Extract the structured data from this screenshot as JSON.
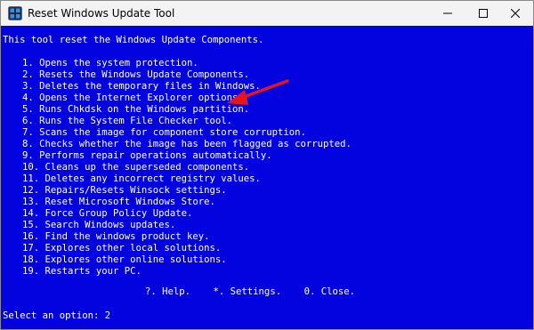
{
  "window": {
    "title": "Reset Windows Update Tool",
    "icon": "terminal-window-icon"
  },
  "console": {
    "intro": "This tool reset the Windows Update Components.",
    "menu": [
      "1. Opens the system protection.",
      "2. Resets the Windows Update Components.",
      "3. Deletes the temporary files in Windows.",
      "4. Opens the Internet Explorer options.",
      "5. Runs Chkdsk on the Windows partition.",
      "6. Runs the System File Checker tool.",
      "7. Scans the image for component store corruption.",
      "8. Checks whether the image has been flagged as corrupted.",
      "9. Performs repair operations automatically.",
      "10. Cleans up the superseded components.",
      "11. Deletes any incorrect registry values.",
      "12. Repairs/Resets Winsock settings.",
      "13. Reset Microsoft Windows Store.",
      "14. Force Group Policy Update.",
      "15. Search Windows updates.",
      "16. Find the windows product key.",
      "17. Explores other local solutions.",
      "18. Explores other online solutions.",
      "19. Restarts your PC."
    ],
    "footer_options": "?. Help.    *. Settings.    0. Close.",
    "prompt": "Select an option: 2"
  },
  "colors": {
    "console_background": "#0303e0",
    "console_text": "#ffffff",
    "arrow": "#e8141c",
    "titlebar": "#f3f3f3"
  }
}
